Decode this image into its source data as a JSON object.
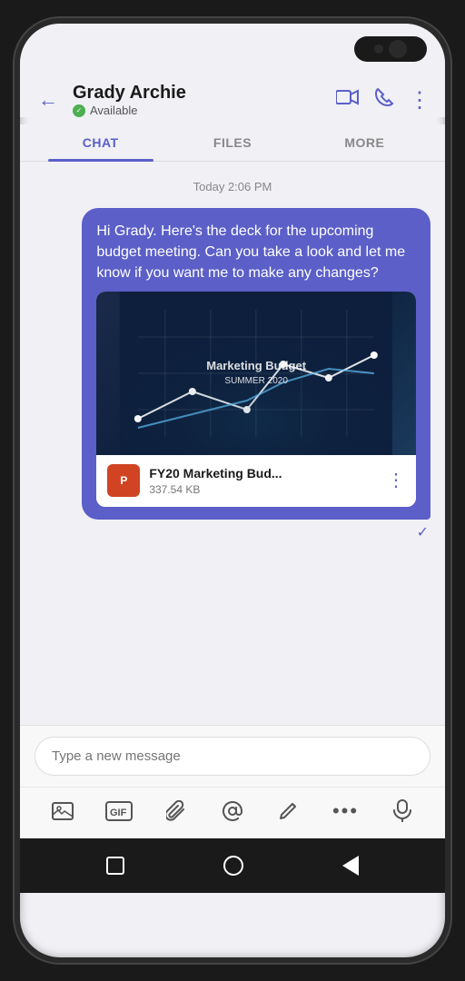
{
  "phone": {
    "status_bar": "camera"
  },
  "header": {
    "contact_name": "Grady Archie",
    "contact_status": "Available",
    "back_label": "←",
    "video_icon": "📹",
    "phone_icon": "📞",
    "more_icon": "⋮"
  },
  "tabs": [
    {
      "label": "CHAT",
      "active": true
    },
    {
      "label": "FILES",
      "active": false
    },
    {
      "label": "MORE",
      "active": false
    }
  ],
  "chat": {
    "timestamp": "Today 2:06 PM",
    "message_text": "Hi Grady. Here's the deck for the upcoming budget meeting. Can you take a look and let me know if you want me to make any changes?",
    "attachment": {
      "title": "Marketing Budget",
      "subtitle": "SUMMER 2020",
      "file_name": "FY20 Marketing Bud...",
      "file_size": "337.54 KB",
      "file_type": "PPT"
    }
  },
  "input": {
    "placeholder": "Type a new message"
  },
  "toolbar": {
    "icons": [
      "image",
      "gif",
      "attach",
      "mention",
      "format",
      "more",
      "mic"
    ]
  }
}
